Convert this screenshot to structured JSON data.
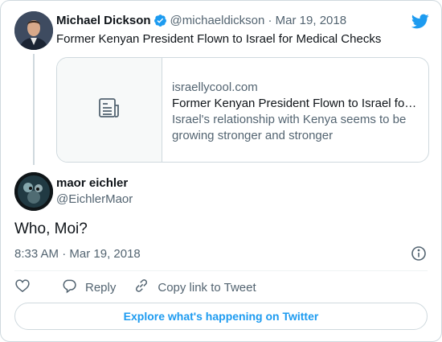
{
  "colors": {
    "accent": "#1d9bf0",
    "text": "#0f1419",
    "muted": "#536471",
    "border": "#cfd9de"
  },
  "quoted_tweet": {
    "author_name": "Michael Dickson",
    "handle": "@michaeldickson",
    "separator": "·",
    "date": "Mar 19, 2018",
    "verified_icon": "verified-badge-icon",
    "text": "Former Kenyan President Flown to Israel for Medical Checks",
    "link_card": {
      "domain": "israellycool.com",
      "title": "Former Kenyan President Flown to Israel for Medical Checks",
      "description": "Israel's relationship with Kenya seems to be growing stronger and stronger",
      "thumbnail_icon": "document-icon"
    }
  },
  "reply_tweet": {
    "author_name": "maor eichler",
    "handle": "@EichlerMaor",
    "text": "Who, Moi?",
    "time": "8:33 AM",
    "separator": "·",
    "date": "Mar 19, 2018"
  },
  "actions": {
    "like_icon": "heart-icon",
    "reply_label": "Reply",
    "copy_link_label": "Copy link to Tweet"
  },
  "explore_label": "Explore what's happening on Twitter",
  "brand_icon": "twitter-bird-icon",
  "info_icon": "info-icon"
}
